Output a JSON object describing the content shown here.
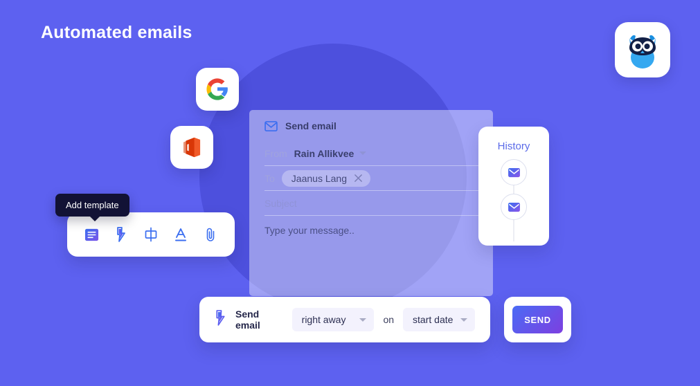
{
  "page": {
    "title": "Automated emails",
    "background_color": "#5d61f0",
    "circle_color": "#4d50dd"
  },
  "logo": {
    "name": "owl-logo",
    "alt": "owl"
  },
  "providers": [
    {
      "name": "google-icon",
      "label": "Google"
    },
    {
      "name": "office-icon",
      "label": "Microsoft Office"
    }
  ],
  "email_card": {
    "header_label": "Send email",
    "header_icon": "envelope-icon",
    "from": {
      "label": "From",
      "value": "Rain Allikvee"
    },
    "to": {
      "label": "To",
      "chip": "Jaanus Lang",
      "remove_icon": "close-icon"
    },
    "subject_placeholder": "Subject",
    "message_placeholder": "Type your message.."
  },
  "history": {
    "title": "History",
    "items": [
      {
        "icon": "envelope-icon"
      },
      {
        "icon": "envelope-icon"
      }
    ]
  },
  "toolbar": {
    "tooltip": "Add template",
    "buttons": [
      {
        "name": "add-template-icon",
        "label": "Add template"
      },
      {
        "name": "lightning-bolt-icon",
        "label": "Automation"
      },
      {
        "name": "merge-field-icon",
        "label": "Merge field"
      },
      {
        "name": "text-format-icon",
        "label": "Text format"
      },
      {
        "name": "attachment-icon",
        "label": "Attachment"
      }
    ]
  },
  "schedule": {
    "icon": "lightning-bolt-icon",
    "label": "Send email",
    "timing": {
      "value": "right away",
      "caret": "chevron-down-icon"
    },
    "conjunction": "on",
    "anchor": {
      "value": "start date",
      "caret": "chevron-down-icon"
    }
  },
  "send": {
    "label": "SEND",
    "gradient_from": "#4a6bf5",
    "gradient_to": "#7d3fe0"
  }
}
